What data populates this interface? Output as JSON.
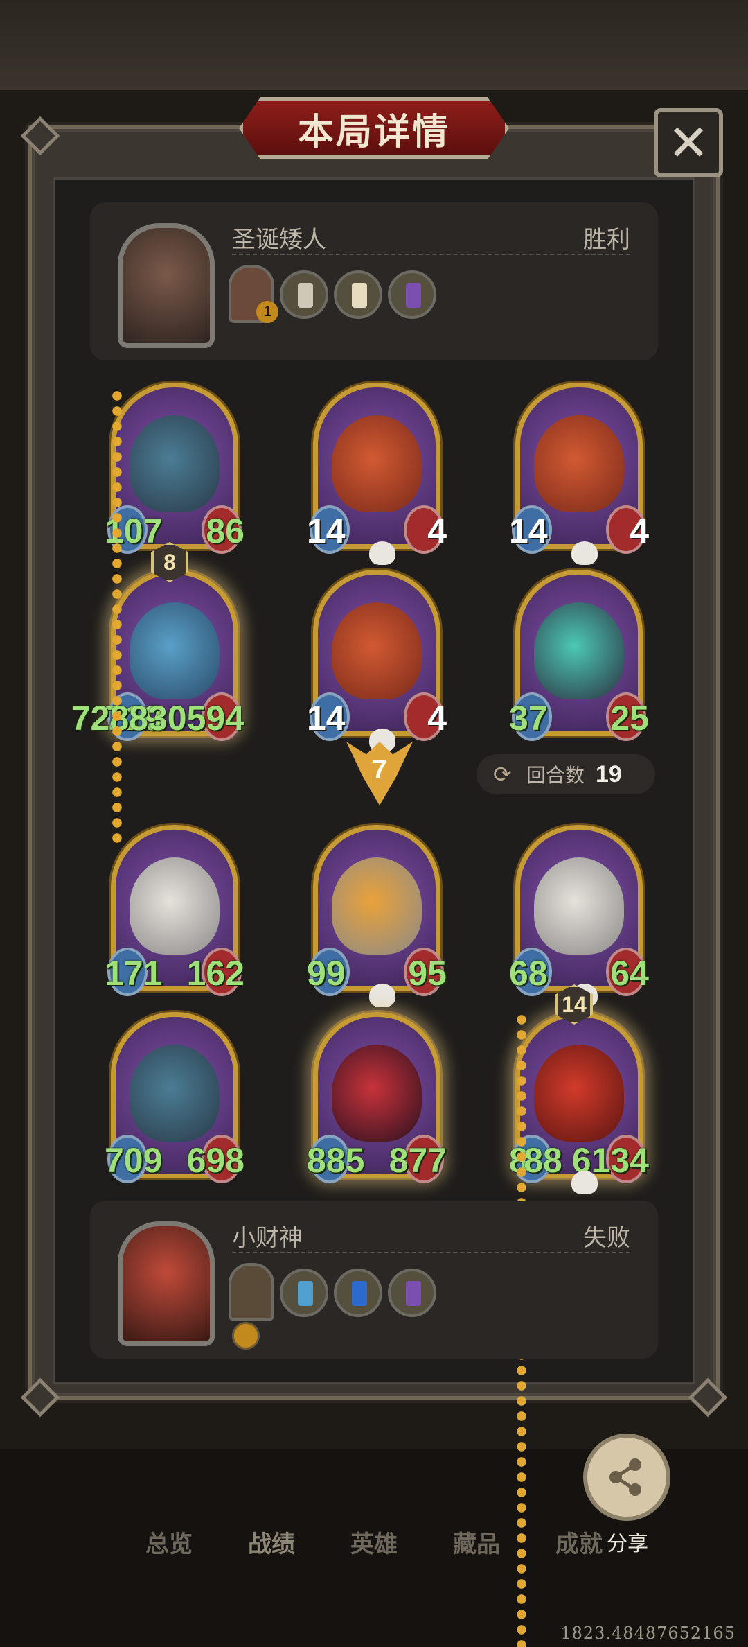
{
  "dialog": {
    "title": "本局详情",
    "close_icon": "close-icon"
  },
  "top_player": {
    "name": "圣诞矮人",
    "result": "胜利",
    "hero_level": "1",
    "items": [
      "ticket-item",
      "scroll-item",
      "card-item"
    ]
  },
  "bottom_player": {
    "name": "小财神",
    "result": "失败",
    "items": [
      "fishbowl-item",
      "blue-orb-item",
      "card-item"
    ]
  },
  "top_board": [
    {
      "attack": "107",
      "health": "86",
      "art": "beast",
      "white": false,
      "skull": false,
      "glow": false,
      "badge": ""
    },
    {
      "attack": "14",
      "health": "4",
      "art": "dragon",
      "white": true,
      "skull": true,
      "glow": false,
      "badge": ""
    },
    {
      "attack": "14",
      "health": "4",
      "art": "dragon",
      "white": true,
      "skull": true,
      "glow": false,
      "badge": ""
    },
    {
      "attack": "719",
      "health": "728830594",
      "art": "blue",
      "white": false,
      "skull": false,
      "glow": true,
      "badge": "8"
    },
    {
      "attack": "14",
      "health": "4",
      "art": "dragon",
      "white": true,
      "skull": true,
      "glow": false,
      "badge": ""
    },
    {
      "attack": "37",
      "health": "25",
      "art": "ghost",
      "white": false,
      "skull": false,
      "glow": false,
      "badge": ""
    }
  ],
  "bottom_board": [
    {
      "attack": "171",
      "health": "162",
      "art": "bird",
      "white": false,
      "skull": false,
      "glow": false,
      "badge": ""
    },
    {
      "attack": "99",
      "health": "95",
      "art": "bird2",
      "white": false,
      "skull": true,
      "glow": false,
      "badge": ""
    },
    {
      "attack": "68",
      "health": "64",
      "art": "bird",
      "white": false,
      "skull": true,
      "glow": false,
      "badge": ""
    },
    {
      "attack": "709",
      "health": "698",
      "art": "beast",
      "white": false,
      "skull": false,
      "glow": false,
      "badge": ""
    },
    {
      "attack": "885",
      "health": "877",
      "art": "clown",
      "white": false,
      "skull": false,
      "glow": true,
      "badge": ""
    },
    {
      "attack": "8",
      "health": "88 6134",
      "art": "demon",
      "white": false,
      "skull": true,
      "glow": true,
      "badge": "14"
    }
  ],
  "attack_marker": "7",
  "rounds": {
    "label": "回合数",
    "value": "19"
  },
  "nav": [
    "总览",
    "战绩",
    "英雄",
    "藏品",
    "成就"
  ],
  "nav_active": "战绩",
  "share_label": "分享",
  "coords": "1823.48487652165"
}
